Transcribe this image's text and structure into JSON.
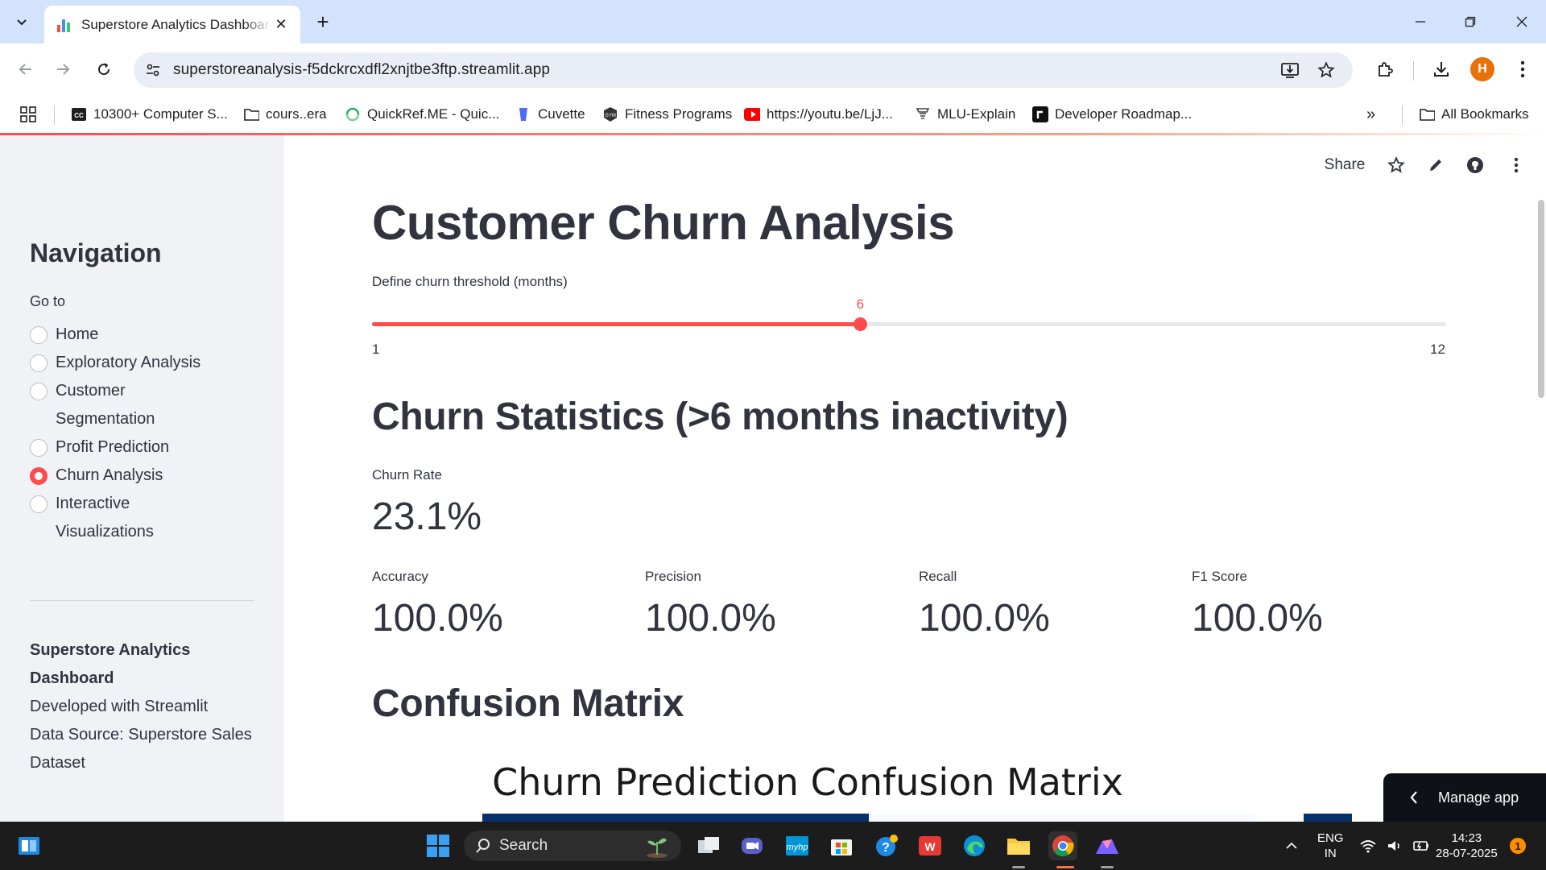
{
  "browser": {
    "tab_title": "Superstore Analytics Dashboard",
    "url": "superstoreanalysis-f5dckrcxdfl2xnjtbe3ftp.streamlit.app",
    "profile_initial": "H",
    "bookmarks": [
      {
        "label": "10300+ Computer S...",
        "icon": "cc-icon"
      },
      {
        "label": "cours..era",
        "icon": "folder-icon"
      },
      {
        "label": "QuickRef.ME - Quic...",
        "icon": "quickref-icon"
      },
      {
        "label": "Cuvette",
        "icon": "cuvette-icon"
      },
      {
        "label": "Fitness Programs",
        "icon": "gym-icon"
      },
      {
        "label": "https://youtu.be/LjJ...",
        "icon": "youtube-icon"
      },
      {
        "label": "MLU-Explain",
        "icon": "mlu-icon"
      },
      {
        "label": "Developer Roadmap...",
        "icon": "roadmap-icon"
      }
    ],
    "all_bookmarks_label": "All Bookmarks"
  },
  "sidebar": {
    "title": "Navigation",
    "goto_label": "Go to",
    "options": [
      {
        "label": "Home",
        "selected": false
      },
      {
        "label": "Exploratory Analysis",
        "selected": false
      },
      {
        "label": "Customer Segmentation",
        "selected": false
      },
      {
        "label": "Profit Prediction",
        "selected": false
      },
      {
        "label": "Churn Analysis",
        "selected": true
      },
      {
        "label": "Interactive Visualizations",
        "selected": false
      }
    ],
    "footer_title_line1": "Superstore Analytics",
    "footer_title_line2": "Dashboard",
    "footer_dev": "Developed with Streamlit",
    "footer_source_line1": "Data Source: Superstore Sales",
    "footer_source_line2": "Dataset"
  },
  "header": {
    "share_label": "Share"
  },
  "main": {
    "title": "Customer Churn Analysis",
    "slider": {
      "label": "Define churn threshold (months)",
      "min": 1,
      "max": 12,
      "value": 6,
      "min_label": "1",
      "max_label": "12",
      "value_label": "6"
    },
    "stats_heading": "Churn Statistics (>6 months inactivity)",
    "churn_rate": {
      "label": "Churn Rate",
      "value": "23.1%"
    },
    "metrics": [
      {
        "label": "Accuracy",
        "value": "100.0%"
      },
      {
        "label": "Precision",
        "value": "100.0%"
      },
      {
        "label": "Recall",
        "value": "100.0%"
      },
      {
        "label": "F1 Score",
        "value": "100.0%"
      }
    ],
    "cm_heading": "Confusion Matrix",
    "cm_chart_title": "Churn Prediction Confusion Matrix",
    "manage_app_label": "Manage app"
  },
  "taskbar": {
    "search_label": "Search",
    "lang_line1": "ENG",
    "lang_line2": "IN",
    "time": "14:23",
    "date": "28-07-2025",
    "notification_count": "1"
  },
  "colors": {
    "accent": "#ff4b4b",
    "text": "#31333f",
    "sidebar_bg": "#f0f2f6",
    "cm_dark": "#08306b"
  }
}
